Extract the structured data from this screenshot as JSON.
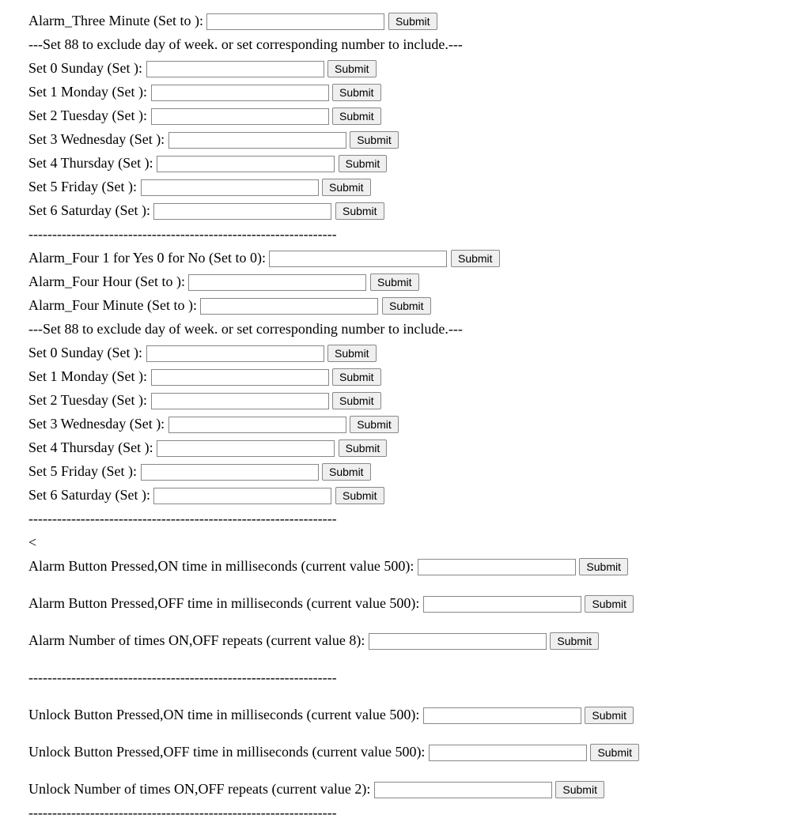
{
  "alarm3_minute_label": "Alarm_Three Minute (Set to ):",
  "dow_note": "---Set 88 to exclude day of week. or set corresponding number to include.---",
  "sunday": "Set 0 Sunday (Set ):",
  "monday": "Set 1 Monday (Set ):",
  "tuesday": "Set 2 Tuesday (Set ):",
  "wednesday": "Set 3 Wednesday (Set ):",
  "thursday": "Set 4 Thursday (Set ):",
  "friday": "Set 5 Friday (Set ):",
  "saturday": "Set 6 Saturday (Set ):",
  "dashes": "-----------------------------------------------------------------",
  "alarm4_enable": "Alarm_Four 1 for Yes 0 for No (Set to 0):",
  "alarm4_hour": "Alarm_Four Hour (Set to ):",
  "alarm4_minute": "Alarm_Four Minute (Set to ):",
  "lt": "<",
  "alarm_on_time": "Alarm Button Pressed,ON time in milliseconds (current value 500):",
  "alarm_off_time": "Alarm Button Pressed,OFF time in milliseconds (current value 500):",
  "alarm_repeats": "Alarm Number of times ON,OFF repeats (current value 8):",
  "unlock_on_time": "Unlock Button Pressed,ON time in milliseconds (current value 500):",
  "unlock_off_time": "Unlock Button Pressed,OFF time in milliseconds (current value 500):",
  "unlock_repeats": "Unlock Number of times ON,OFF repeats (current value 2):",
  "submit": "Submit"
}
